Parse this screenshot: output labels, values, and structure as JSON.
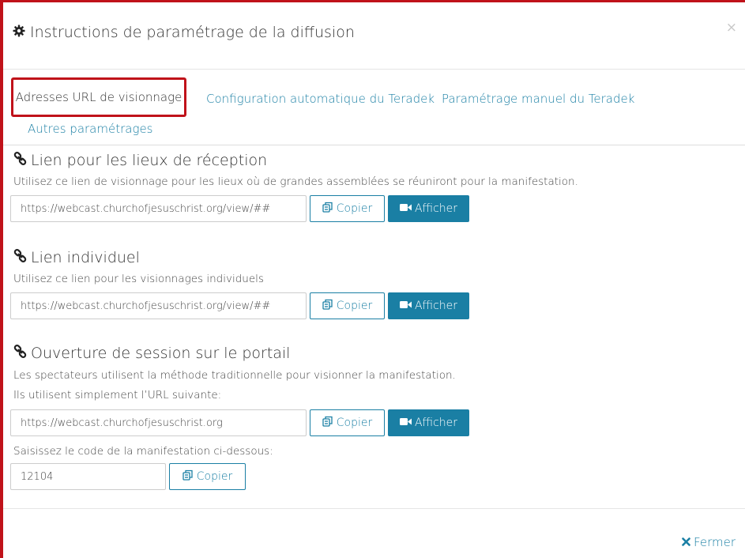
{
  "header": {
    "title": "Instructions de paramétrage de la diffusion",
    "close_glyph": "×"
  },
  "tabs": [
    {
      "label": "Adresses URL de visionnage",
      "active": true
    },
    {
      "label": "Configuration automatique du Teradek",
      "active": false
    },
    {
      "label": "Paramétrage manuel du Teradek",
      "active": false
    },
    {
      "label": "Autres paramétrages",
      "active": false
    }
  ],
  "sections": {
    "venues": {
      "title": "Lien pour les lieux de réception",
      "description": "Utilisez ce lien de visionnage pour les lieux où de grandes assemblées se réuniront pour la manifestation.",
      "url": "https://webcast.churchofjesuschrist.org/view/##",
      "copy_label": "Copier",
      "view_label": "Afficher"
    },
    "individual": {
      "title": "Lien individuel",
      "description": "Utilisez ce lien pour les visionnages individuels",
      "url": "https://webcast.churchofjesuschrist.org/view/##",
      "copy_label": "Copier",
      "view_label": "Afficher"
    },
    "portal": {
      "title": "Ouverture de session sur le portail",
      "description1": "Les spectateurs utilisent la méthode traditionnelle pour visionner la manifestation.",
      "description2": "Ils utilisent simplement l’URL suivante:",
      "url": "https://webcast.churchofjesuschrist.org",
      "copy_label": "Copier",
      "view_label": "Afficher",
      "code_label": "Saisissez le code de la manifestation ci-dessous:",
      "code": "12104",
      "code_copy_label": "Copier"
    }
  },
  "footer": {
    "close_label": "Fermer"
  },
  "icons": {
    "header": "cog-icon",
    "section": "link-icon",
    "copy": "copy-icon",
    "view": "video-camera-icon",
    "close": "times-icon"
  },
  "colors": {
    "accent": "#1a7fa4",
    "highlight": "#c0121a",
    "text": "#333333"
  }
}
